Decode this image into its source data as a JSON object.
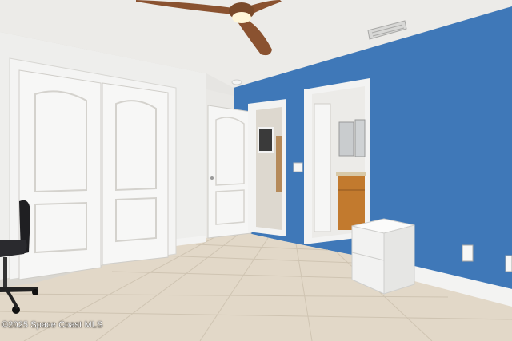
{
  "photo": {
    "watermark": "©2025 Space Coast MLS",
    "colors": {
      "accent_wall": "#3f78b8",
      "ceiling": "#ecebe8",
      "white_wall": "#eeeeec",
      "floor_tile": "#e2d8c8",
      "ceiling_fan_blade": "#8a5230",
      "vanity_wood": "#c27a2e"
    },
    "objects": [
      "ceiling-fan",
      "air-vent",
      "closet-bifold-doors",
      "bedroom-door",
      "hallway-doorway",
      "bathroom-doorway",
      "framed-picture",
      "light-switch",
      "bathroom-vanity",
      "bathroom-mirror",
      "white-nightstand",
      "office-chair",
      "wall-outlet",
      "baseboard",
      "tile-floor"
    ]
  }
}
